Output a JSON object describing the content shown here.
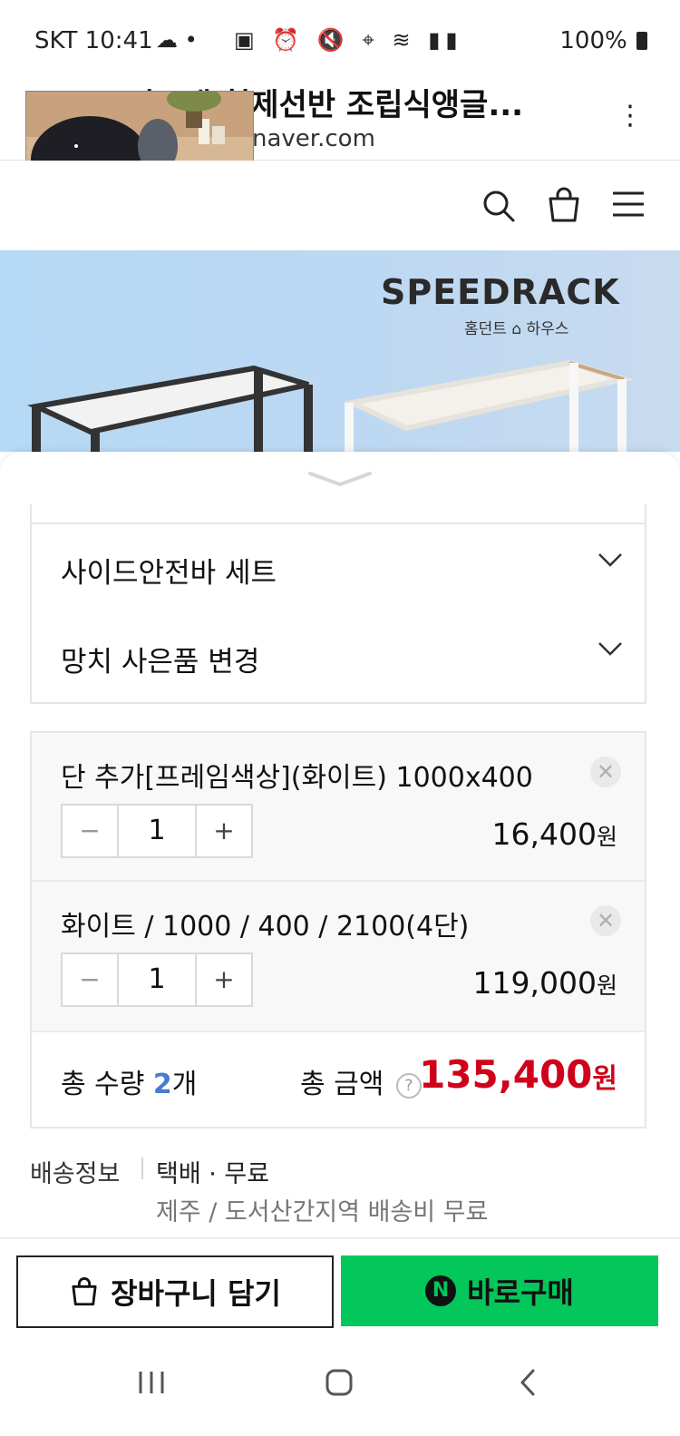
{
  "status_bar": {
    "carrier_time": "SKT 10:41",
    "battery": "100%"
  },
  "browser": {
    "title": "스피드랙 철제선반 조립식앵글...",
    "url": "naver.com"
  },
  "banner": {
    "brand": "SPEEDRACK",
    "sub": "홈던트 ⌂ 하우스"
  },
  "options": [
    {
      "label": "사이드안전바 세트"
    },
    {
      "label": "망치 사은품 변경"
    }
  ],
  "items": [
    {
      "name": "단 추가[프레임색상](화이트) 1000x400",
      "qty": "1",
      "price": "16,400",
      "unit": "원"
    },
    {
      "name": "화이트 / 1000 / 400 / 2100(4단)",
      "qty": "1",
      "price": "119,000",
      "unit": "원"
    }
  ],
  "totals": {
    "qty_label": "총 수량",
    "qty_value": "2",
    "qty_unit": "개",
    "amount_label": "총 금액",
    "amount_value": "135,400",
    "amount_unit": "원"
  },
  "shipping": {
    "label": "배송정보",
    "value": "택배 · 무료",
    "note": "제주 / 도서산간지역 배송비 무료"
  },
  "buttons": {
    "cart": "장바구니 담기",
    "buy": "바로구매",
    "buy_badge": "N"
  },
  "colors": {
    "buy_green": "#03c75a",
    "total_red": "#d0021b",
    "qty_blue": "#4a7bd0"
  }
}
